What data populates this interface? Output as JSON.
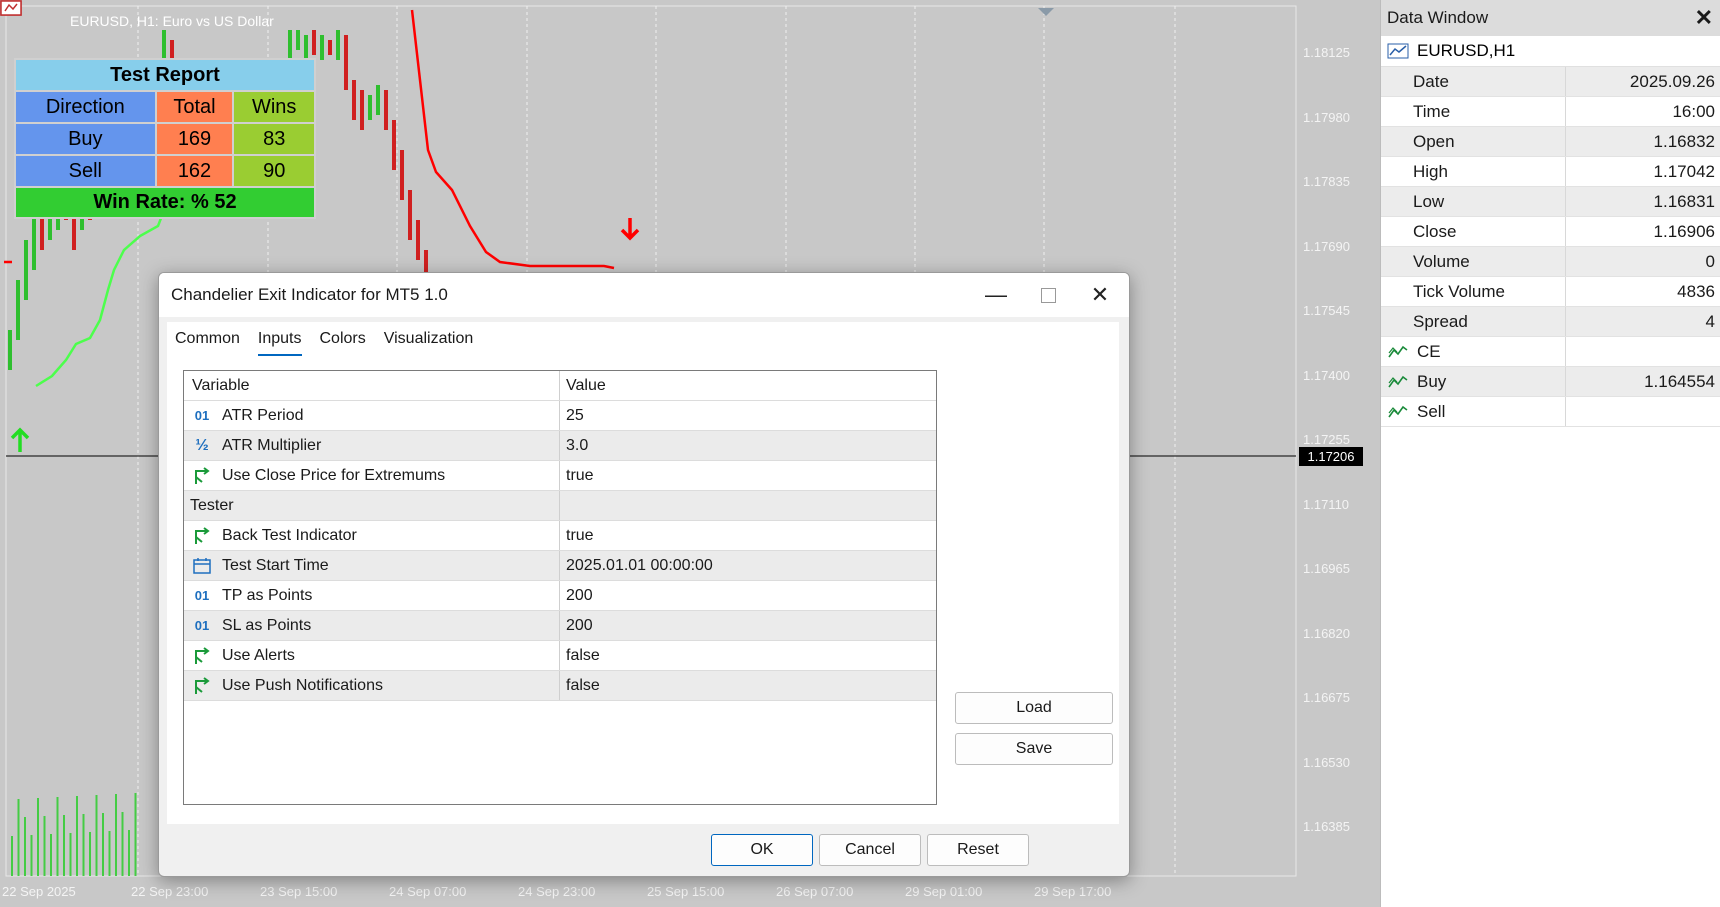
{
  "chart": {
    "symbol_title": "EURUSD, H1:  Euro vs US Dollar",
    "price_ticks": [
      "1.18125",
      "1.17980",
      "1.17835",
      "1.17690",
      "1.17545",
      "1.17400",
      "1.17255",
      "1.17110",
      "1.16965",
      "1.16820",
      "1.16675",
      "1.16530",
      "1.16385"
    ],
    "current_price": "1.17206",
    "time_ticks": [
      "22 Sep 2025",
      "22 Sep 23:00",
      "23 Sep 15:00",
      "24 Sep 07:00",
      "24 Sep 23:00",
      "25 Sep 15:00",
      "26 Sep 07:00",
      "29 Sep 01:00",
      "29 Sep 17:00"
    ],
    "colors": {
      "buy_line": "#4cff4c",
      "sell_line": "#ff0000",
      "candle_bull": "#2fbf2f",
      "candle_bear": "#d02020"
    }
  },
  "report": {
    "title": "Test Report",
    "headers": [
      "Direction",
      "Total",
      "Wins"
    ],
    "rows": [
      {
        "direction": "Buy",
        "total": "169",
        "wins": "83"
      },
      {
        "direction": "Sell",
        "total": "162",
        "wins": "90"
      }
    ],
    "win_rate": "Win Rate: %  52"
  },
  "data_window": {
    "title": "Data Window",
    "close_icon": "close-icon",
    "symbol": "EURUSD,H1",
    "rows": [
      {
        "key": "Date",
        "value": "2025.09.26"
      },
      {
        "key": "Time",
        "value": "16:00"
      },
      {
        "key": "Open",
        "value": "1.16832"
      },
      {
        "key": "High",
        "value": "1.17042"
      },
      {
        "key": "Low",
        "value": "1.16831"
      },
      {
        "key": "Close",
        "value": "1.16906"
      },
      {
        "key": "Volume",
        "value": "0"
      },
      {
        "key": "Tick Volume",
        "value": "4836"
      },
      {
        "key": "Spread",
        "value": "4"
      }
    ],
    "indicators": [
      {
        "key": "CE",
        "value": ""
      },
      {
        "key": "Buy",
        "value": "1.164554"
      },
      {
        "key": "Sell",
        "value": ""
      }
    ]
  },
  "dialog": {
    "title": "Chandelier Exit Indicator for MT5 1.0",
    "tabs": [
      "Common",
      "Inputs",
      "Colors",
      "Visualization"
    ],
    "active_tab": "Inputs",
    "columns": [
      "Variable",
      "Value"
    ],
    "params": [
      {
        "icon": "int-icon",
        "variable": "ATR Period",
        "value": "25"
      },
      {
        "icon": "double-icon",
        "variable": "ATR Multiplier",
        "value": "3.0"
      },
      {
        "icon": "bool-icon",
        "variable": "Use Close Price for Extremums",
        "value": "true"
      },
      {
        "icon": "",
        "variable": "Tester",
        "value": ""
      },
      {
        "icon": "bool-icon",
        "variable": "Back Test Indicator",
        "value": "true"
      },
      {
        "icon": "datetime-icon",
        "variable": "Test Start Time",
        "value": "2025.01.01 00:00:00"
      },
      {
        "icon": "int-icon",
        "variable": "TP as Points",
        "value": "200"
      },
      {
        "icon": "int-icon",
        "variable": "SL as Points",
        "value": "200"
      },
      {
        "icon": "bool-icon",
        "variable": "Use Alerts",
        "value": "false"
      },
      {
        "icon": "bool-icon",
        "variable": "Use Push Notifications",
        "value": "false"
      }
    ],
    "buttons": {
      "load": "Load",
      "save": "Save",
      "ok": "OK",
      "cancel": "Cancel",
      "reset": "Reset"
    }
  }
}
